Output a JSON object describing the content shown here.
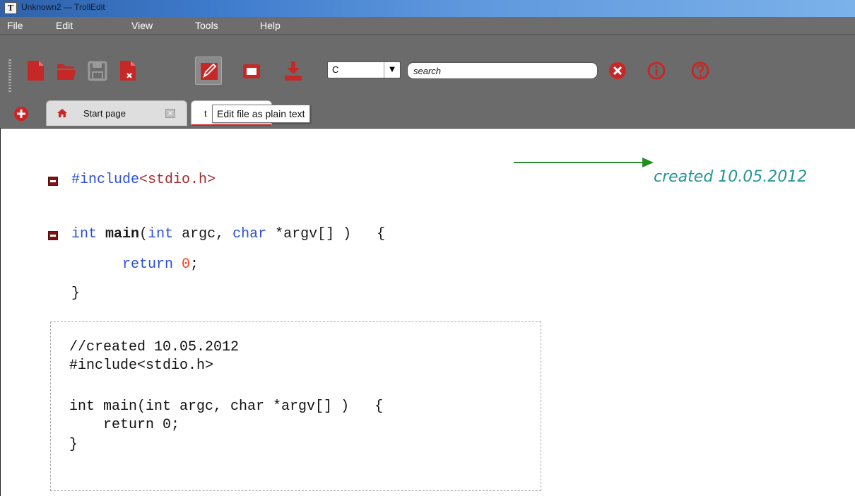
{
  "window": {
    "title": "Unknown2 — TrollEdit",
    "app_icon_glyph": "T"
  },
  "menu": [
    "File",
    "Edit",
    "View",
    "Tools",
    "Help"
  ],
  "toolbar": {
    "language": "C",
    "search_placeholder": "search",
    "buttons": [
      "new-file-icon",
      "open-folder-icon",
      "save-icon",
      "close-file-icon",
      "edit-plain-text-icon",
      "window-icon",
      "download-icon",
      "clear-search-icon",
      "info-icon",
      "help-icon"
    ],
    "accent_color": "#c62828"
  },
  "tabs": {
    "start_page": "Start page",
    "current_tab_visible": "t",
    "tooltip": "Edit file as plain text"
  },
  "editor": {
    "annotation": "created 10.05.2012",
    "code": {
      "include_directive": "#include",
      "include_file": "<stdio.h>",
      "sig_int1": "int",
      "sig_main": "main",
      "sig_paren": "(",
      "sig_int2": "int",
      "sig_argc": " argc, ",
      "sig_char": "char",
      "sig_rest": " *argv[] )   {",
      "ret_kw": "return",
      "ret_num": "0",
      "ret_semi": ";",
      "close_brace": "}"
    },
    "preview": [
      "//created 10.05.2012",
      "#include<stdio.h>",
      "",
      "int main(int argc, char *argv[] )   {",
      "    return 0;",
      "}"
    ]
  }
}
